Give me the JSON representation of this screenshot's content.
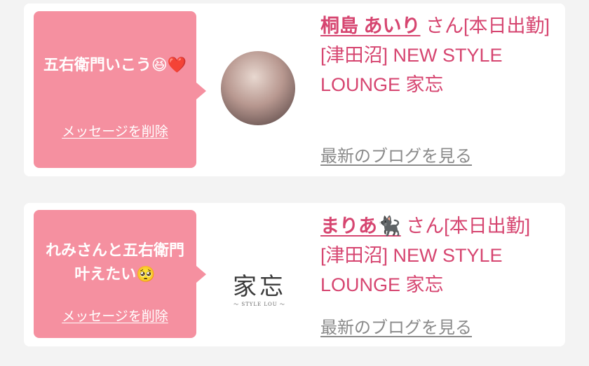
{
  "entries": [
    {
      "message": "五右衛門いこう😆❤️",
      "delete_label": "メッセージを削除",
      "name": "桐島 あいり",
      "honorific": "さん",
      "status": "[本日出勤]",
      "shop": "[津田沼] NEW STYLE LOUNGE 家忘",
      "blog_link": "最新のブログを見る",
      "image": "avatar-photo"
    },
    {
      "message": "れみさんと五右衛門叶えたい🥺",
      "delete_label": "メッセージを削除",
      "name": "まりあ🐈‍⬛",
      "honorific": "さん",
      "status": "[本日出勤]",
      "shop": "[津田沼] NEW STYLE LOUNGE 家忘",
      "blog_link": "最新のブログを見る",
      "image": "shop-logo"
    }
  ],
  "logo": {
    "main": "家忘",
    "sub": "～ STYLE LOU ～"
  },
  "colors": {
    "bubble": "#f590a0",
    "accent": "#d64570",
    "link_gray": "#8a8a8a",
    "background": "#f3f3f3"
  }
}
